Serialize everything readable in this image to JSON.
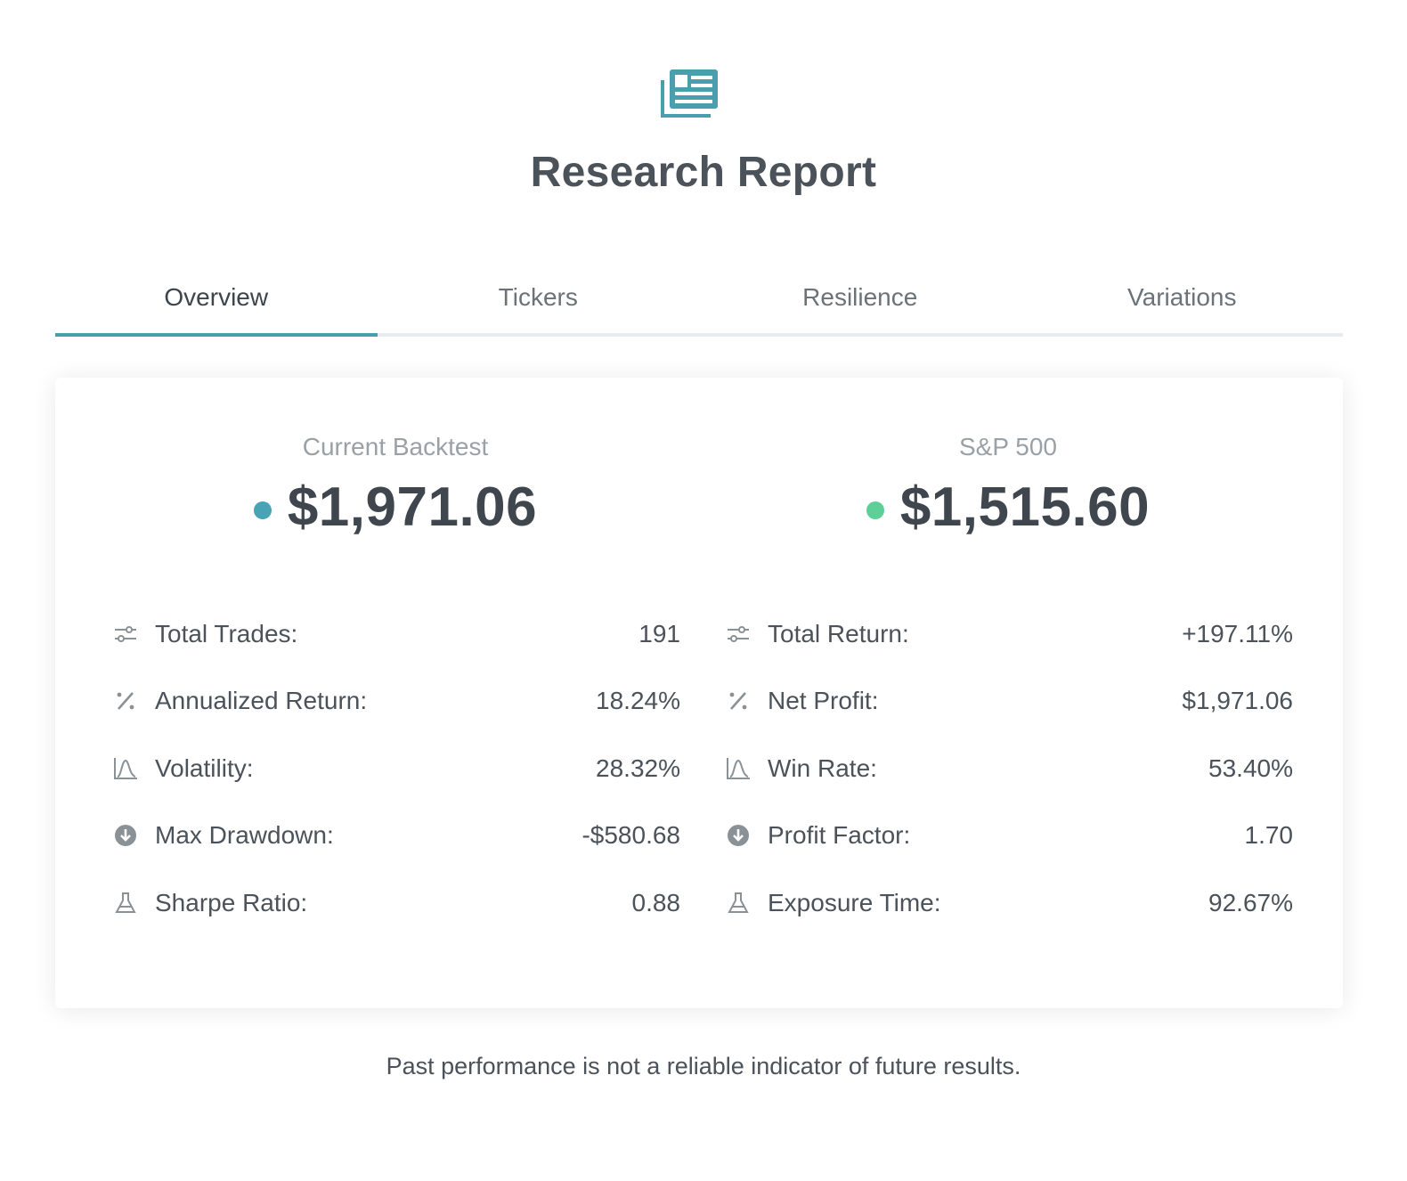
{
  "header": {
    "icon": "newspaper-icon",
    "title": "Research Report"
  },
  "tabs": [
    {
      "label": "Overview",
      "active": true
    },
    {
      "label": "Tickers",
      "active": false
    },
    {
      "label": "Resilience",
      "active": false
    },
    {
      "label": "Variations",
      "active": false
    }
  ],
  "colors": {
    "accent": "#4a9fae",
    "backtest_dot": "#4aa3b4",
    "sp500_dot": "#5fcf98"
  },
  "summary": {
    "backtest": {
      "label": "Current Backtest",
      "value": "$1,971.06"
    },
    "benchmark": {
      "label": "S&P 500",
      "value": "$1,515.60"
    }
  },
  "left_stats": [
    {
      "icon": "sliders-icon",
      "label": "Total Trades:",
      "value": "191"
    },
    {
      "icon": "percent-icon",
      "label": "Annualized Return:",
      "value": "18.24%"
    },
    {
      "icon": "chart-curve-icon",
      "label": "Volatility:",
      "value": "28.32%"
    },
    {
      "icon": "arrow-down-circle-icon",
      "label": "Max Drawdown:",
      "value": "-$580.68"
    },
    {
      "icon": "flask-icon",
      "label": "Sharpe Ratio:",
      "value": "0.88"
    }
  ],
  "right_stats": [
    {
      "icon": "sliders-icon",
      "label": "Total Return:",
      "value": "+197.11%"
    },
    {
      "icon": "percent-icon",
      "label": "Net Profit:",
      "value": "$1,971.06"
    },
    {
      "icon": "chart-curve-icon",
      "label": "Win Rate:",
      "value": "53.40%"
    },
    {
      "icon": "arrow-down-circle-icon",
      "label": "Profit Factor:",
      "value": "1.70"
    },
    {
      "icon": "flask-icon",
      "label": "Exposure Time:",
      "value": "92.67%"
    }
  ],
  "footer": {
    "disclaimer": "Past performance is not a reliable indicator of future results."
  }
}
